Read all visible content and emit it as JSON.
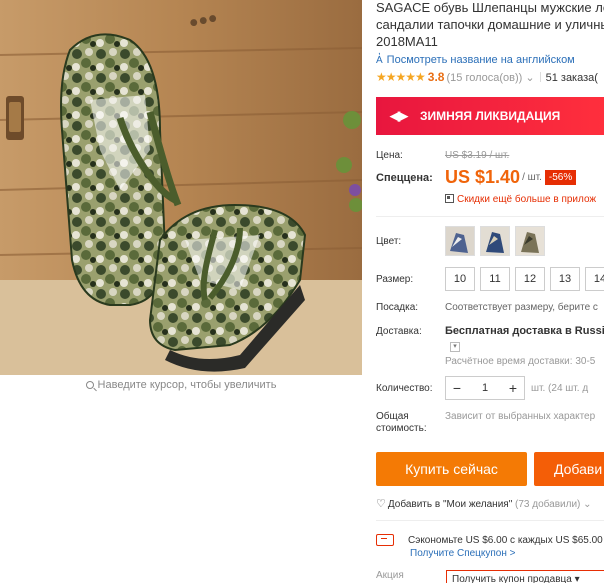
{
  "product": {
    "title": "SAGACE обувь Шлепанцы мужские лет\nсандалии тапочки домашние и уличны\n2018MA11",
    "translate_link": "Посмотреть название на английском",
    "rating": {
      "stars": "★★★★★",
      "score": "3.8",
      "votes": "(15 голоса(ов))",
      "orders": "51 заказа("
    }
  },
  "image": {
    "zoom_hint": "Наведите курсор, чтобы увеличить"
  },
  "promo": {
    "label": "ЗИМНЯЯ ЛИКВИДАЦИЯ",
    "color": "#e8163e"
  },
  "price": {
    "label": "Цена:",
    "old": "US $3.19 / шт.",
    "special_label": "Спеццена:",
    "new": "US $1.40",
    "unit": "/ шт.",
    "discount": "-56%",
    "coupons_link": "Скидки ещё больше в прилож",
    "accent": "#f0640a"
  },
  "color": {
    "label": "Цвет:",
    "swatches": [
      "swatch-1",
      "swatch-2",
      "swatch-3"
    ]
  },
  "size": {
    "label": "Размер:",
    "options": [
      "10",
      "11",
      "12",
      "13",
      "14"
    ]
  },
  "fit": {
    "label": "Посадка:",
    "value": "Соответствует размеру, берите с"
  },
  "delivery": {
    "label": "Доставка:",
    "value": "Бесплатная доставка в Russian",
    "estimate": "Расчётное время доставки: 30-5"
  },
  "quantity": {
    "label": "Количество:",
    "minus": "−",
    "value": "1",
    "plus": "+",
    "stock": "шт. (24 шт. д"
  },
  "total": {
    "label_line1": "Общая",
    "label_line2": "стоимость:",
    "value": "Зависит от выбранных характер"
  },
  "actions": {
    "buy": "Купить сейчас",
    "cart": "Добави",
    "wishlist": "Добавить в \"Мои желания\"",
    "wishlist_count": "(73 добавили)"
  },
  "coupon": {
    "save_text": "Сэкономьте US $6.00 с каждых US $65.00",
    "get_link": "Получите Спецкупон >",
    "action_label": "Акция",
    "get_seller_coupon": "Получить купон продавца ▾"
  }
}
